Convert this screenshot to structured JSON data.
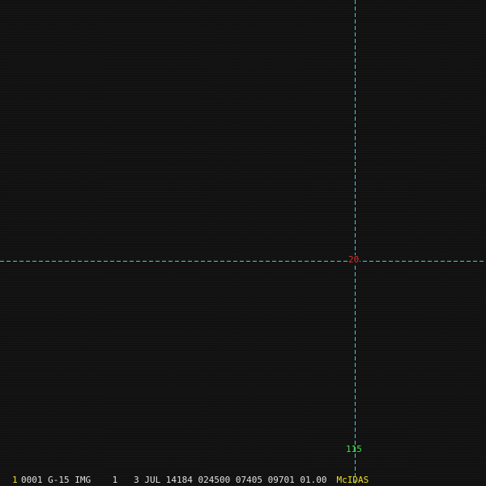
{
  "colors": {
    "background": "#121212",
    "grid_line": "#3fd0d0",
    "latitude_label": "#d83030",
    "longitude_label": "#40e040",
    "status_text": "#e0e0e0",
    "frame_number": "#f0e020",
    "system_name": "#f0e020"
  },
  "grid": {
    "latitude_label": "20",
    "longitude_label": "115"
  },
  "status_bar": {
    "frame_number": "1",
    "text": "0001 G-15 IMG    1   3 JUL 14184 024500 07405 09701 01.00",
    "system_name": "McIDAS"
  }
}
